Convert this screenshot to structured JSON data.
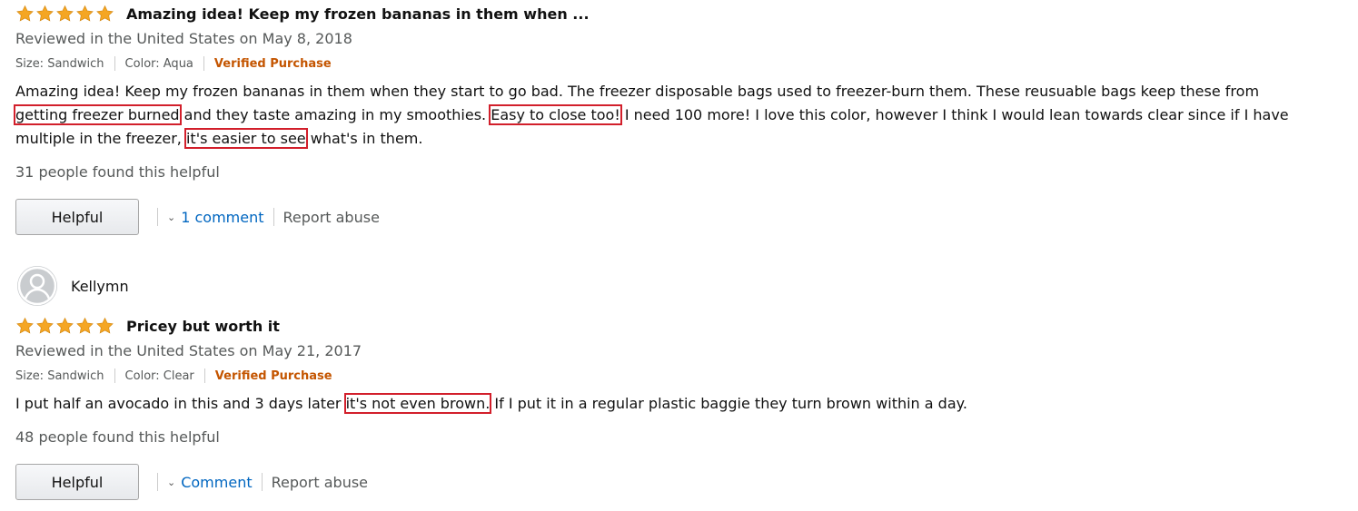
{
  "reviews": [
    {
      "rating": 5,
      "title": "Amazing idea! Keep my frozen bananas in them when ...",
      "date_line": "Reviewed in the United States on May 8, 2018",
      "size": "Size: Sandwich",
      "color": "Color: Aqua",
      "verified": "Verified Purchase",
      "body": [
        {
          "t": "Amazing idea! Keep my frozen bananas in them when they start to go bad. The freezer disposable bags used to freezer-burn them. These reusuable bags keep these from ",
          "hl": false
        },
        {
          "t": "getting freezer burned",
          "hl": true
        },
        {
          "t": " and they taste amazing in my smoothies. ",
          "hl": false
        },
        {
          "t": "Easy to close too!",
          "hl": true
        },
        {
          "t": " I need 100 more! I love this color, however I think I would lean towards clear since if I have multiple in the freezer, ",
          "hl": false
        },
        {
          "t": "it's easier to see",
          "hl": true
        },
        {
          "t": " what's in them.",
          "hl": false
        }
      ],
      "helpful_count": "31 people found this helpful",
      "helpful_label": "Helpful",
      "comment_label": "1 comment",
      "report_label": "Report abuse"
    },
    {
      "profile_name": "Kellymn",
      "rating": 5,
      "title": "Pricey but worth it",
      "date_line": "Reviewed in the United States on May 21, 2017",
      "size": "Size: Sandwich",
      "color": "Color: Clear",
      "verified": "Verified Purchase",
      "body": [
        {
          "t": "I put half an avocado in this and 3 days later ",
          "hl": false
        },
        {
          "t": "it's not even brown.",
          "hl": true
        },
        {
          "t": " If I put it in a regular plastic baggie they turn brown within a day.",
          "hl": false
        }
      ],
      "helpful_count": "48 people found this helpful",
      "helpful_label": "Helpful",
      "comment_label": "Comment",
      "report_label": "Report abuse"
    }
  ],
  "colors": {
    "star": "#f5a623",
    "verified": "#c45500",
    "link": "#0066c0",
    "highlight_box": "#d21f2b"
  }
}
